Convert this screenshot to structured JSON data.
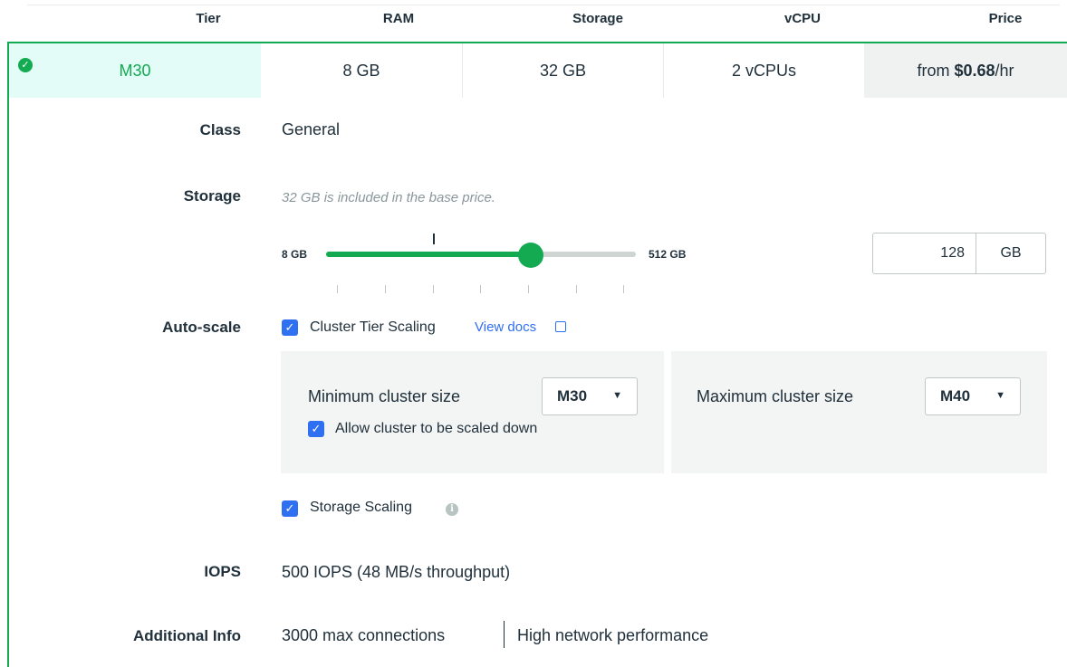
{
  "header": {
    "tier": "Tier",
    "ram": "RAM",
    "storage": "Storage",
    "vcpu": "vCPU",
    "price": "Price"
  },
  "selected_row": {
    "tier": "M30",
    "ram": "8 GB",
    "storage": "32 GB",
    "vcpu": "2 vCPUs",
    "price_prefix": "from ",
    "price_amount": "$0.68",
    "price_suffix": "/hr"
  },
  "details": {
    "class_label": "Class",
    "class_value": "General",
    "storage_label": "Storage",
    "storage_hint": "32 GB is included in the base price.",
    "slider": {
      "min_label": "8 GB",
      "max_label": "512 GB",
      "fraction": 0.66
    },
    "storage_value": "128",
    "storage_unit": "GB",
    "autoscale_label": "Auto-scale",
    "cluster_tier_scaling": "Cluster Tier Scaling",
    "view_docs": "View docs",
    "min_cluster_label": "Minimum cluster size",
    "min_cluster_value": "M30",
    "allow_scale_down": "Allow cluster to be scaled down",
    "max_cluster_label": "Maximum cluster size",
    "max_cluster_value": "M40",
    "storage_scaling": "Storage Scaling",
    "iops_label": "IOPS",
    "iops_value": "500 IOPS (48 MB/s throughput)",
    "additional_label": "Additional Info",
    "connections": "3000 max connections",
    "network": "High network performance"
  },
  "icons": {
    "selected": "check-circle-icon",
    "checkbox": "checkmark-icon",
    "external": "external-link-icon",
    "info": "info-icon",
    "caret": "caret-down-icon"
  },
  "colors": {
    "accent_green": "#13aa52",
    "link_blue": "#2f6ff2"
  }
}
